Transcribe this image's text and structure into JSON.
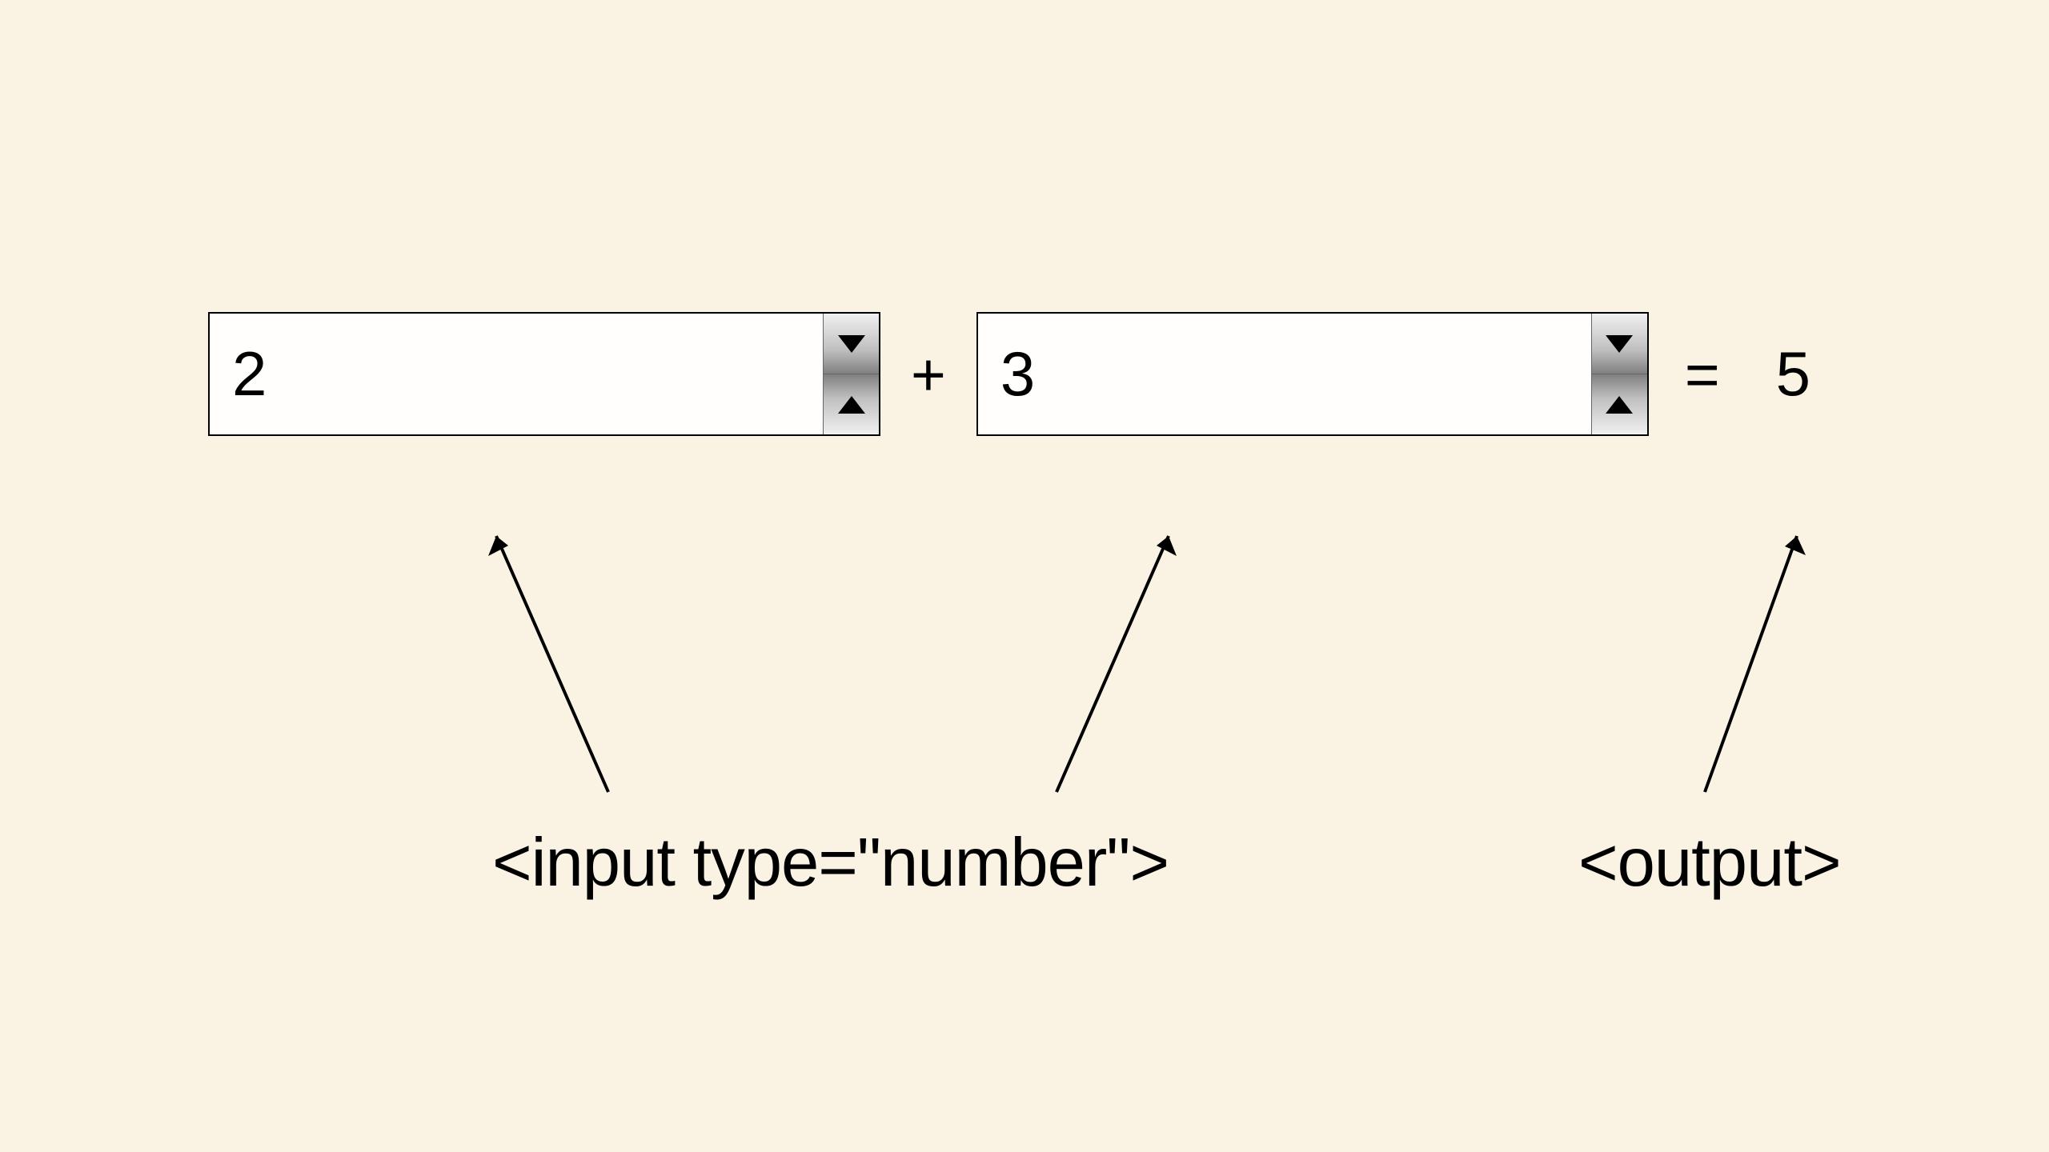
{
  "input1_value": "2",
  "operator_plus": "+",
  "input2_value": "3",
  "equals_sign": "=",
  "output_value": "5",
  "label_input": "<input type=\"number\">",
  "label_output": "<output>"
}
